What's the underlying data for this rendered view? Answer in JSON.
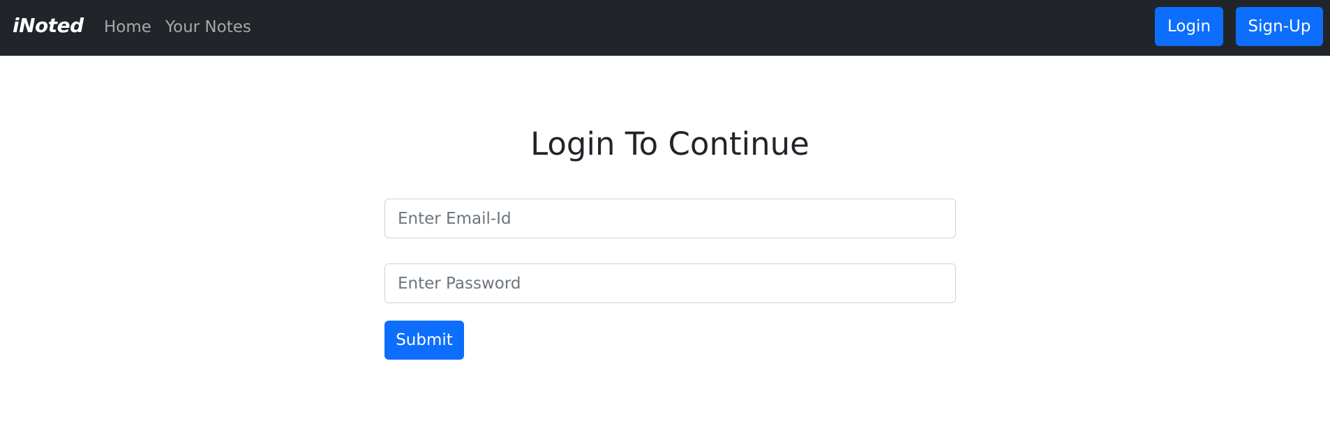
{
  "navbar": {
    "brand": "iNoted",
    "links": [
      {
        "label": "Home"
      },
      {
        "label": "Your Notes"
      }
    ],
    "login_label": "Login",
    "signup_label": "Sign-Up"
  },
  "main": {
    "title": "Login To Continue",
    "email_placeholder": "Enter Email-Id",
    "password_placeholder": "Enter Password",
    "submit_label": "Submit"
  },
  "colors": {
    "navbar_bg": "#212529",
    "primary": "#0d6efd"
  }
}
